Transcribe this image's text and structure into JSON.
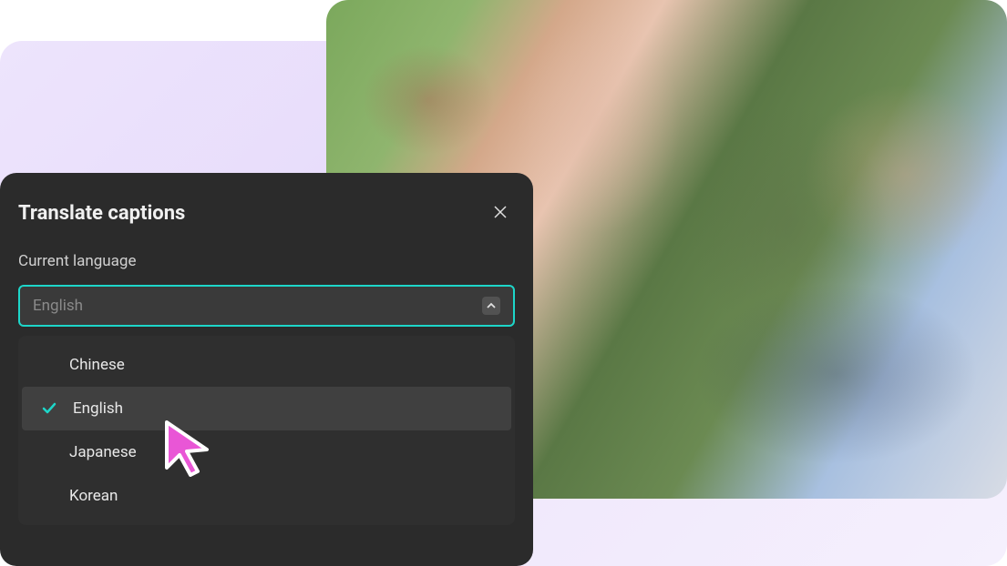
{
  "panel": {
    "title": "Translate captions",
    "label": "Current language",
    "selected_value": "English"
  },
  "options": [
    {
      "label": "Chinese",
      "selected": false
    },
    {
      "label": "English",
      "selected": true
    },
    {
      "label": "Japanese",
      "selected": false
    },
    {
      "label": "Korean",
      "selected": false
    }
  ],
  "colors": {
    "accent": "#1dd6c9",
    "cursor": "#e956d6"
  }
}
